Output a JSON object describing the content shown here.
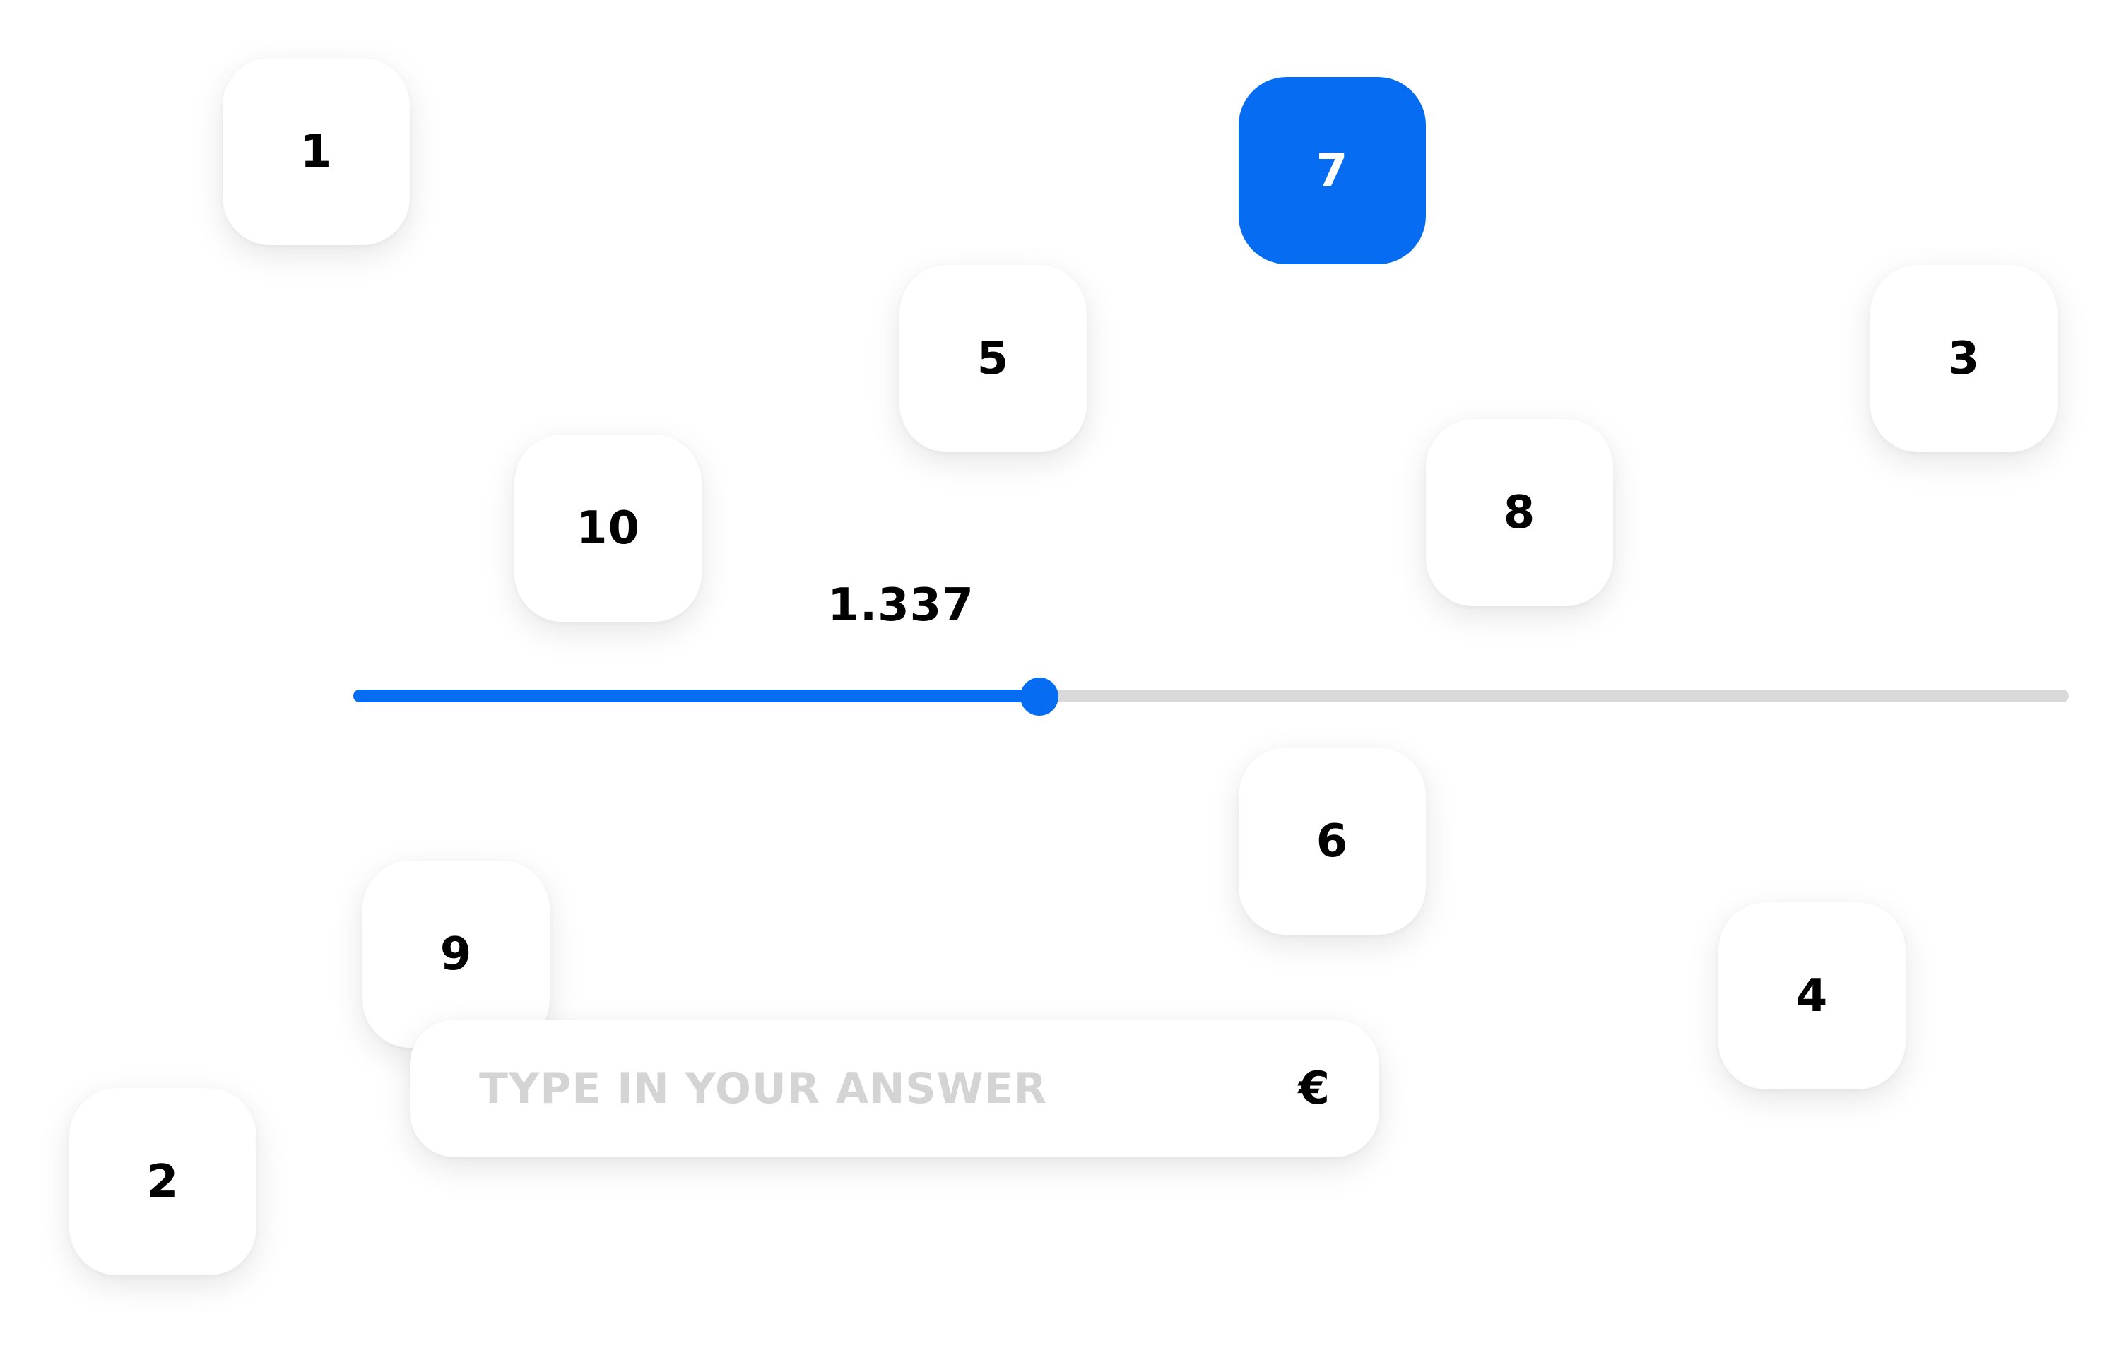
{
  "colors": {
    "accent": "#066df2",
    "track": "#d9d9d9",
    "placeholder": "#d4d4d4",
    "tile_background": "#ffffff",
    "text": "#000000"
  },
  "options": [
    {
      "label": "1",
      "selected": false
    },
    {
      "label": "7",
      "selected": true
    },
    {
      "label": "5",
      "selected": false
    },
    {
      "label": "3",
      "selected": false
    },
    {
      "label": "10",
      "selected": false
    },
    {
      "label": "8",
      "selected": false
    },
    {
      "label": "6",
      "selected": false
    },
    {
      "label": "9",
      "selected": false
    },
    {
      "label": "4",
      "selected": false
    },
    {
      "label": "2",
      "selected": false
    }
  ],
  "slider": {
    "value_label": "1.337",
    "fill_fraction": 0.4
  },
  "answer": {
    "placeholder": "TYPE IN YOUR ANSWER",
    "value": "",
    "currency_symbol": "€"
  }
}
